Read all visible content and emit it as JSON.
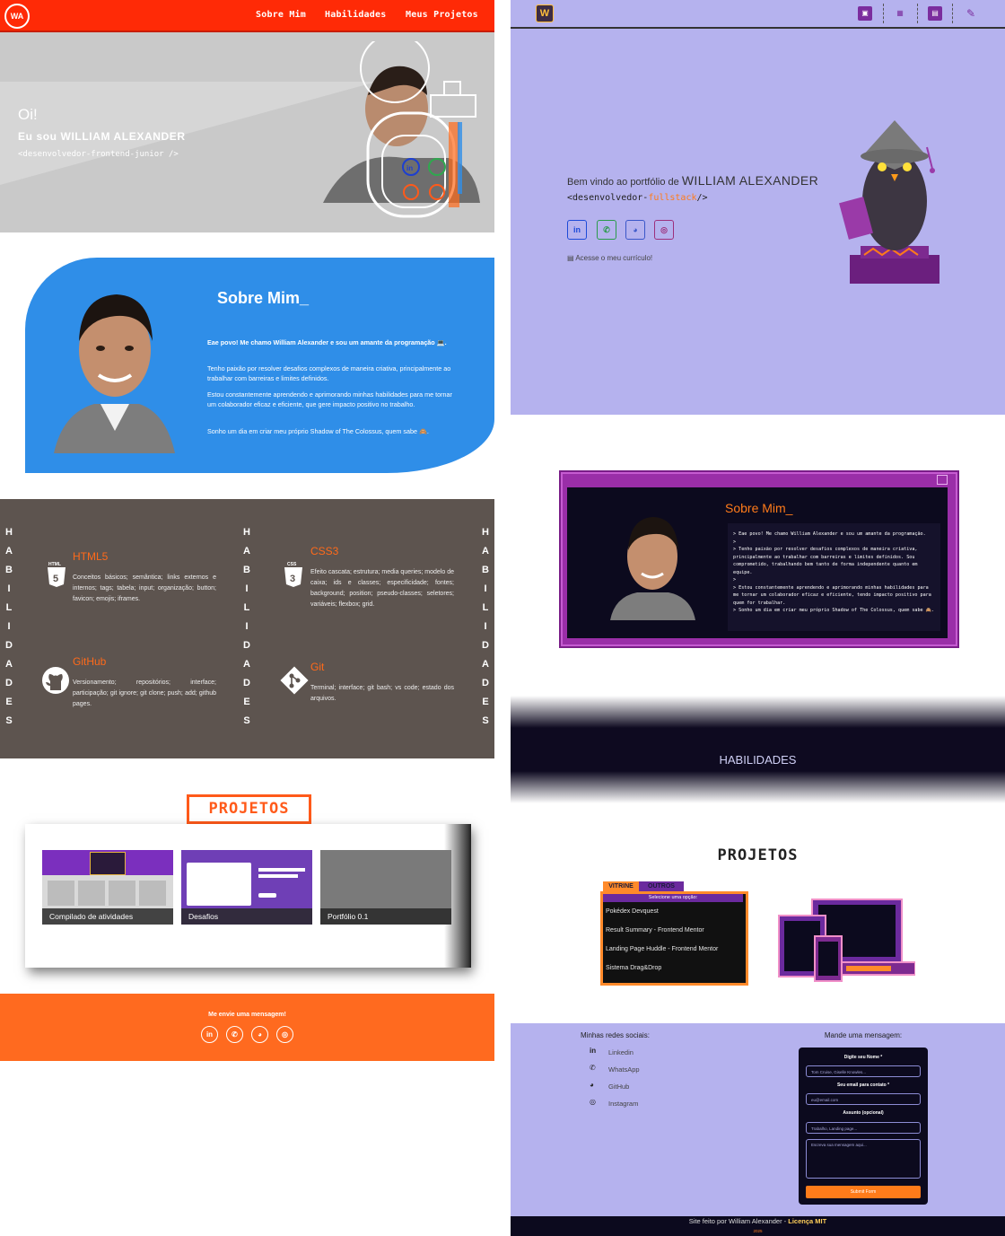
{
  "left": {
    "nav": {
      "logo": "WA",
      "links": [
        "Sobre Mim",
        "Habilidades",
        "Meus Projetos"
      ]
    },
    "hero": {
      "greeting": "Oi!",
      "name": "Eu sou WILLIAM ALEXANDER",
      "tag": "<desenvolvedor-frontend-junior />"
    },
    "about": {
      "title": "Sobre Mim_",
      "paragraphs": [
        "Eae povo! Me chamo William Alexander e sou um amante da programação 💻.",
        "Tenho paixão por resolver desafios complexos de maneira criativa, principalmente ao trabalhar com barreiras e limites definidos.",
        "Estou constantemente aprendendo e aprimorando minhas habilidades para me tornar um colaborador eficaz e eficiente, que gere impacto positivo no trabalho.",
        "Sonho um dia em criar meu próprio Shadow of The Colossus, quem sabe 🙈."
      ]
    },
    "skills": {
      "vertical_word": [
        "H",
        "A",
        "B",
        "I",
        "L",
        "I",
        "D",
        "A",
        "D",
        "E",
        "S"
      ],
      "items": [
        {
          "title": "HTML5",
          "icon": "html5-icon",
          "text": "Conceitos básicos; semântica; links externos e internos; tags; tabela; input; organização; button; favicon; emojis; iframes."
        },
        {
          "title": "CSS3",
          "icon": "css3-icon",
          "text": "Efeito cascata; estrutura; media queries; modelo de caixa; ids e classes; especificidade; fontes; background; position; pseudo-classes; seletores; variáveis; flexbox; grid."
        },
        {
          "title": "GitHub",
          "icon": "github-icon",
          "text": "Versionamento; repositórios; interface; participação; git ignore; git clone; push; add; github pages."
        },
        {
          "title": "Git",
          "icon": "git-icon",
          "text": "Terminal; interface; git bash; vs code; estado dos arquivos."
        }
      ]
    },
    "projects": {
      "title": "PROJETOS",
      "cards": [
        "Compilado de atividades",
        "Desafios",
        "Portfólio 0.1"
      ]
    },
    "footer": {
      "title": "Me envie uma mensagem!",
      "icons": [
        "linkedin-icon",
        "whatsapp-icon",
        "github-icon",
        "instagram-icon"
      ]
    }
  },
  "right": {
    "nav": {
      "logo": "W",
      "icons": [
        "profile-icon",
        "skills-icon",
        "projects-icon",
        "contact-icon"
      ]
    },
    "hero": {
      "welcome": "Bem vindo ao portfólio de",
      "name": "WILLIAM ALEXANDER",
      "dev_prefix": "<desenvolvedor-",
      "dev_role": "fullstack",
      "dev_suffix": "/>",
      "cv": "Acesse o meu currículo!",
      "icons": [
        "linkedin-icon",
        "whatsapp-icon",
        "github-icon",
        "instagram-icon"
      ]
    },
    "about": {
      "title": "Sobre Mim_",
      "lines": [
        "> Eae povo! Me chamo William Alexander e sou um amante da programação.",
        ">",
        "> Tenho paixão por resolver desafios complexos de maneira criativa, principalmente ao trabalhar com barreiras e limites definidos. Sou comprometido, trabalhando bem tanto de forma independente quanto em equipe.",
        ">",
        "> Estou constantemente aprendendo e aprimorando minhas habilidades para me tornar um colaborador eficaz e eficiente, tendo impacto positivo para quem for trabalhar.",
        "> Sonho um dia em criar meu próprio Shadow of The Colossus, quem sabe 🙈."
      ]
    },
    "skills_title": "HABILIDADES",
    "projects": {
      "title": "PROJETOS",
      "tabs": [
        "VITRINE",
        "OUTROS"
      ],
      "select_hint": "Selecione uma opção:",
      "items": [
        "Pokédex Devquest",
        "Result Summary - Frontend Mentor",
        "Landing Page Huddle - Frontend Mentor",
        "Sistema Drag&Drop"
      ]
    },
    "contact": {
      "social_title": "Minhas redes sociais:",
      "social": [
        "Linkedin",
        "WhatsApp",
        "GitHub",
        "Instagram"
      ],
      "form_title": "Mande uma mensagem:",
      "name_label": "Digite seu Nome *",
      "name_placeholder": "Tom Cruise, Giselle Knowles...",
      "email_label": "Seu email para contato *",
      "email_placeholder": "eu@email.com",
      "subject_label": "Assunto (opcional)",
      "subject_placeholder": "Trabalho, Landing page...",
      "message_placeholder": "Escreva sua mensagem aqui...",
      "submit": "Submit Form"
    },
    "footer": {
      "text": "Site feito por William Alexander -",
      "license": "Licença MIT",
      "year": "2025"
    }
  },
  "colors": {
    "left_nav": "#ff2a06",
    "left_about": "#2f8ee8",
    "left_skills": "#5d544f",
    "accent_orange": "#ff6a1f",
    "right_bg": "#b5b2ee",
    "right_dark": "#0c0a1e",
    "right_purple": "#9a2ea8"
  }
}
